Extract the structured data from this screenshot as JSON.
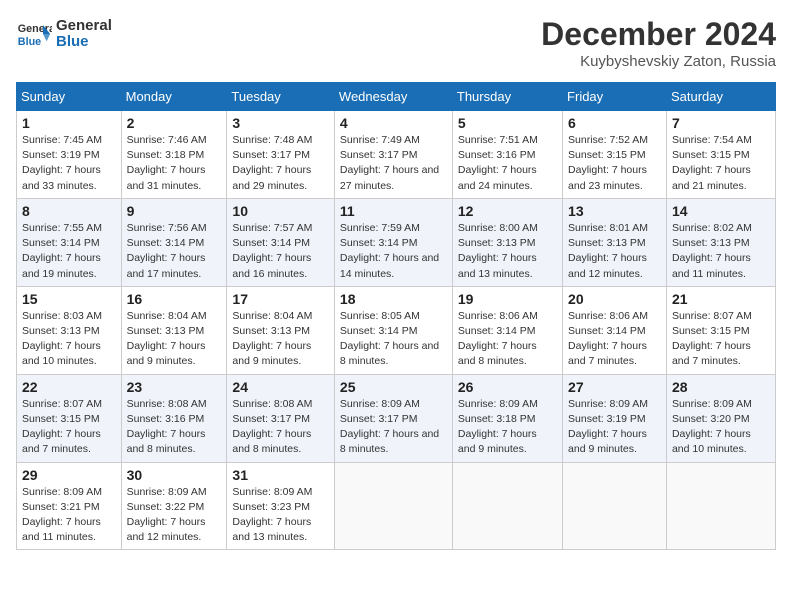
{
  "header": {
    "logo_general": "General",
    "logo_blue": "Blue",
    "month_title": "December 2024",
    "location": "Kuybyshevskiy Zaton, Russia"
  },
  "days_of_week": [
    "Sunday",
    "Monday",
    "Tuesday",
    "Wednesday",
    "Thursday",
    "Friday",
    "Saturday"
  ],
  "weeks": [
    [
      {
        "day": "1",
        "sunrise": "7:45 AM",
        "sunset": "3:19 PM",
        "daylight": "7 hours and 33 minutes."
      },
      {
        "day": "2",
        "sunrise": "7:46 AM",
        "sunset": "3:18 PM",
        "daylight": "7 hours and 31 minutes."
      },
      {
        "day": "3",
        "sunrise": "7:48 AM",
        "sunset": "3:17 PM",
        "daylight": "7 hours and 29 minutes."
      },
      {
        "day": "4",
        "sunrise": "7:49 AM",
        "sunset": "3:17 PM",
        "daylight": "7 hours and 27 minutes."
      },
      {
        "day": "5",
        "sunrise": "7:51 AM",
        "sunset": "3:16 PM",
        "daylight": "7 hours and 24 minutes."
      },
      {
        "day": "6",
        "sunrise": "7:52 AM",
        "sunset": "3:15 PM",
        "daylight": "7 hours and 23 minutes."
      },
      {
        "day": "7",
        "sunrise": "7:54 AM",
        "sunset": "3:15 PM",
        "daylight": "7 hours and 21 minutes."
      }
    ],
    [
      {
        "day": "8",
        "sunrise": "7:55 AM",
        "sunset": "3:14 PM",
        "daylight": "7 hours and 19 minutes."
      },
      {
        "day": "9",
        "sunrise": "7:56 AM",
        "sunset": "3:14 PM",
        "daylight": "7 hours and 17 minutes."
      },
      {
        "day": "10",
        "sunrise": "7:57 AM",
        "sunset": "3:14 PM",
        "daylight": "7 hours and 16 minutes."
      },
      {
        "day": "11",
        "sunrise": "7:59 AM",
        "sunset": "3:14 PM",
        "daylight": "7 hours and 14 minutes."
      },
      {
        "day": "12",
        "sunrise": "8:00 AM",
        "sunset": "3:13 PM",
        "daylight": "7 hours and 13 minutes."
      },
      {
        "day": "13",
        "sunrise": "8:01 AM",
        "sunset": "3:13 PM",
        "daylight": "7 hours and 12 minutes."
      },
      {
        "day": "14",
        "sunrise": "8:02 AM",
        "sunset": "3:13 PM",
        "daylight": "7 hours and 11 minutes."
      }
    ],
    [
      {
        "day": "15",
        "sunrise": "8:03 AM",
        "sunset": "3:13 PM",
        "daylight": "7 hours and 10 minutes."
      },
      {
        "day": "16",
        "sunrise": "8:04 AM",
        "sunset": "3:13 PM",
        "daylight": "7 hours and 9 minutes."
      },
      {
        "day": "17",
        "sunrise": "8:04 AM",
        "sunset": "3:13 PM",
        "daylight": "7 hours and 9 minutes."
      },
      {
        "day": "18",
        "sunrise": "8:05 AM",
        "sunset": "3:14 PM",
        "daylight": "7 hours and 8 minutes."
      },
      {
        "day": "19",
        "sunrise": "8:06 AM",
        "sunset": "3:14 PM",
        "daylight": "7 hours and 8 minutes."
      },
      {
        "day": "20",
        "sunrise": "8:06 AM",
        "sunset": "3:14 PM",
        "daylight": "7 hours and 7 minutes."
      },
      {
        "day": "21",
        "sunrise": "8:07 AM",
        "sunset": "3:15 PM",
        "daylight": "7 hours and 7 minutes."
      }
    ],
    [
      {
        "day": "22",
        "sunrise": "8:07 AM",
        "sunset": "3:15 PM",
        "daylight": "7 hours and 7 minutes."
      },
      {
        "day": "23",
        "sunrise": "8:08 AM",
        "sunset": "3:16 PM",
        "daylight": "7 hours and 8 minutes."
      },
      {
        "day": "24",
        "sunrise": "8:08 AM",
        "sunset": "3:17 PM",
        "daylight": "7 hours and 8 minutes."
      },
      {
        "day": "25",
        "sunrise": "8:09 AM",
        "sunset": "3:17 PM",
        "daylight": "7 hours and 8 minutes."
      },
      {
        "day": "26",
        "sunrise": "8:09 AM",
        "sunset": "3:18 PM",
        "daylight": "7 hours and 9 minutes."
      },
      {
        "day": "27",
        "sunrise": "8:09 AM",
        "sunset": "3:19 PM",
        "daylight": "7 hours and 9 minutes."
      },
      {
        "day": "28",
        "sunrise": "8:09 AM",
        "sunset": "3:20 PM",
        "daylight": "7 hours and 10 minutes."
      }
    ],
    [
      {
        "day": "29",
        "sunrise": "8:09 AM",
        "sunset": "3:21 PM",
        "daylight": "7 hours and 11 minutes."
      },
      {
        "day": "30",
        "sunrise": "8:09 AM",
        "sunset": "3:22 PM",
        "daylight": "7 hours and 12 minutes."
      },
      {
        "day": "31",
        "sunrise": "8:09 AM",
        "sunset": "3:23 PM",
        "daylight": "7 hours and 13 minutes."
      },
      null,
      null,
      null,
      null
    ]
  ],
  "labels": {
    "sunrise": "Sunrise:",
    "sunset": "Sunset:",
    "daylight": "Daylight:"
  }
}
